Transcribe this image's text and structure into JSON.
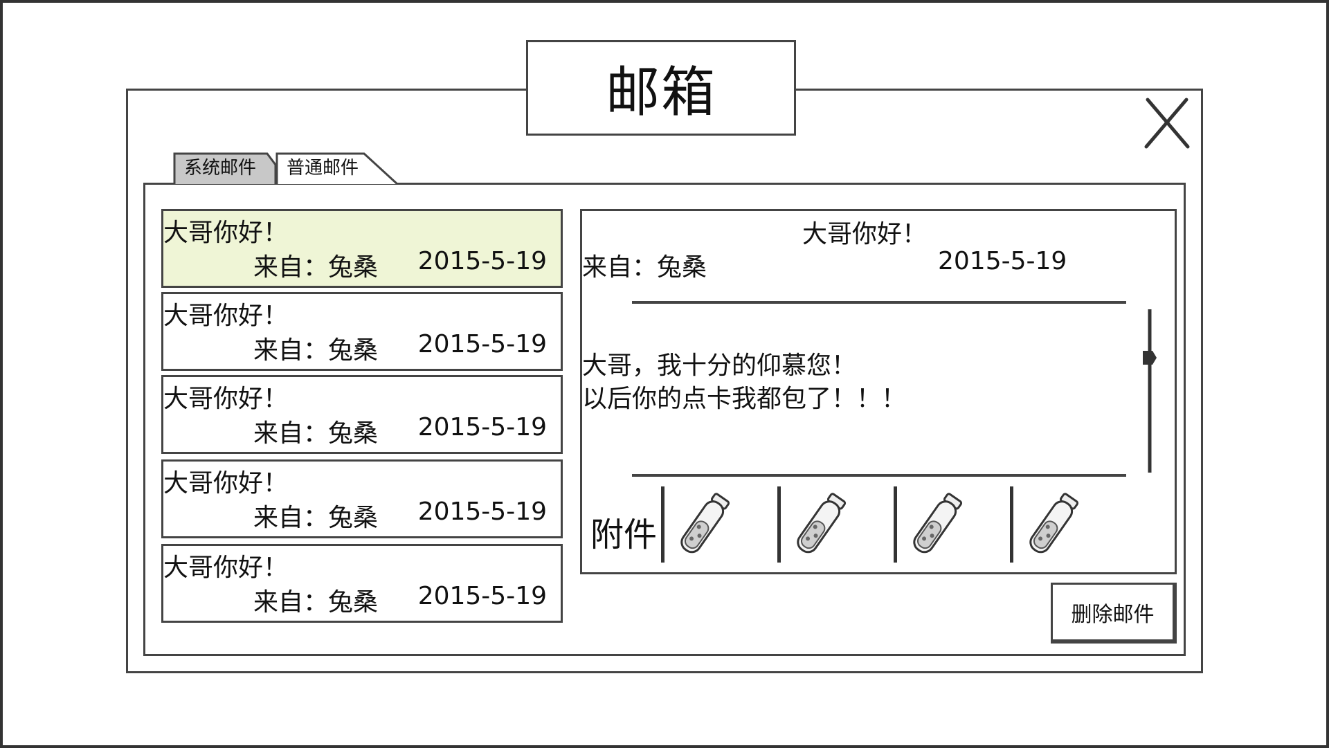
{
  "window": {
    "title": "邮箱"
  },
  "tabs": [
    {
      "label": "系统邮件",
      "active": false
    },
    {
      "label": "普通邮件",
      "active": true
    }
  ],
  "mail_list": [
    {
      "subject": "大哥你好！",
      "from": "来自：兔桑",
      "date": "2015-5-19",
      "selected": true
    },
    {
      "subject": "大哥你好！",
      "from": "来自：兔桑",
      "date": "2015-5-19",
      "selected": false
    },
    {
      "subject": "大哥你好！",
      "from": "来自：兔桑",
      "date": "2015-5-19",
      "selected": false
    },
    {
      "subject": "大哥你好！",
      "from": "来自：兔桑",
      "date": "2015-5-19",
      "selected": false
    },
    {
      "subject": "大哥你好！",
      "from": "来自：兔桑",
      "date": "2015-5-19",
      "selected": false
    }
  ],
  "detail": {
    "subject": "大哥你好！",
    "from": "来自：兔桑",
    "date": "2015-5-19",
    "body": "大哥，我十分的仰慕您！\n以后你的点卡我都包了！！！",
    "attachments_label": "附件",
    "attachments": [
      {
        "icon": "potion-vial-icon"
      },
      {
        "icon": "potion-vial-icon"
      },
      {
        "icon": "potion-vial-icon"
      },
      {
        "icon": "potion-vial-icon"
      }
    ]
  },
  "actions": {
    "delete_label": "删除邮件"
  },
  "colors": {
    "selected_row": "#eff5d6",
    "inactive_tab": "#c8c8c8",
    "border": "#444444"
  }
}
